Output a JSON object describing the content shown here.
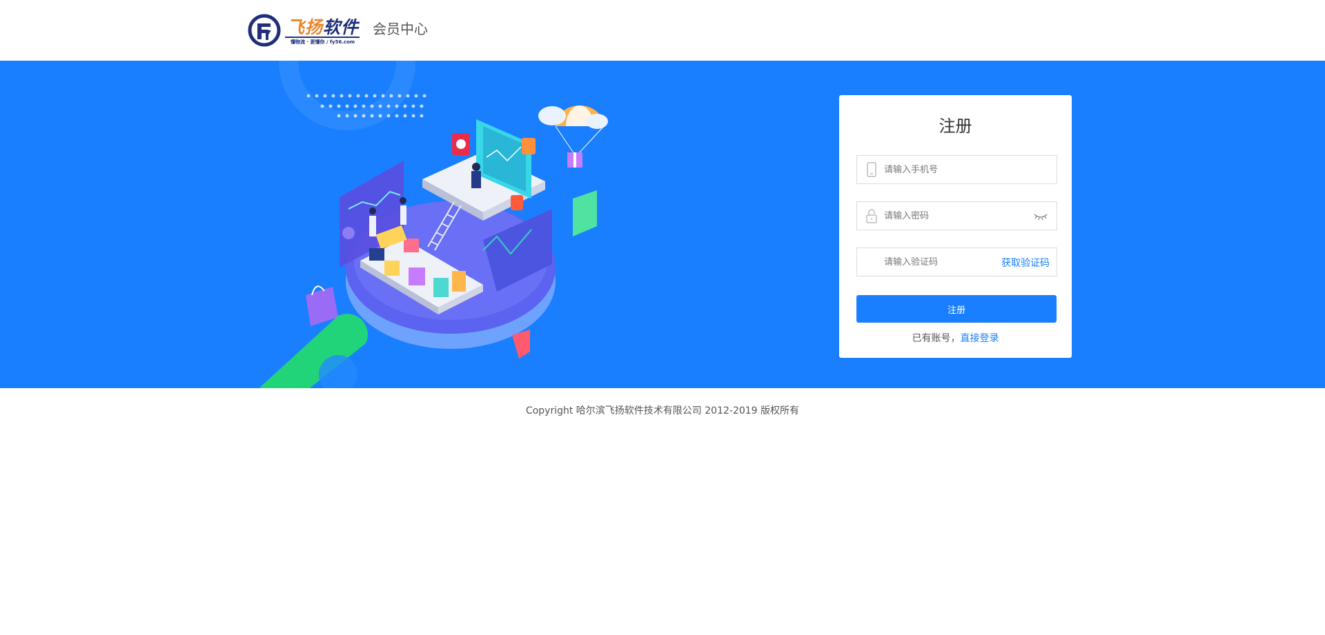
{
  "header": {
    "logo_name_a": "飞扬",
    "logo_name_b": "软件",
    "logo_slogan": "懂物流 · 更懂你 / fy56.com",
    "title": "会员中心"
  },
  "register": {
    "title": "注册",
    "phone_placeholder": "请输入手机号",
    "password_placeholder": "请输入密码",
    "code_placeholder": "请输入验证码",
    "get_code": "获取验证码",
    "submit": "注册",
    "has_account": "已有账号，",
    "login_link": "直接登录"
  },
  "footer": {
    "copyright": "Copyright 哈尔滨飞扬软件技术有限公司 2012-2019 版权所有"
  },
  "colors": {
    "banner": "#1a7ffe",
    "accent": "#1a7ffe",
    "logo_orange": "#e8852c",
    "logo_navy": "#1f2f7a"
  },
  "icons": [
    "phone-icon",
    "lock-icon",
    "eye-icon"
  ]
}
